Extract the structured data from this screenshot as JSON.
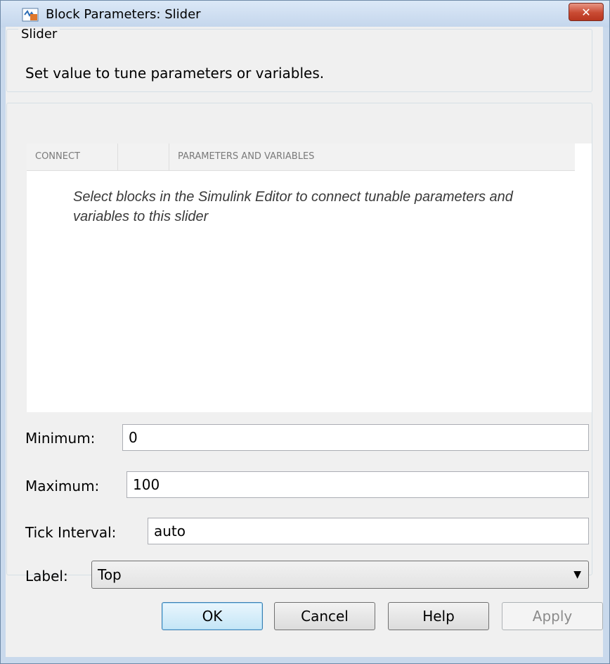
{
  "window": {
    "title": "Block Parameters: Slider",
    "close_glyph": "✕"
  },
  "block_group": {
    "legend": "Slider",
    "description": "Set value to tune parameters or variables."
  },
  "connect_table": {
    "columns": [
      "CONNECT",
      "",
      "PARAMETERS AND VARIABLES"
    ],
    "empty_hint": "Select blocks in the Simulink Editor to connect tunable parameters and variables to this slider"
  },
  "fields": {
    "minimum": {
      "label": "Minimum:",
      "value": "0"
    },
    "maximum": {
      "label": "Maximum:",
      "value": "100"
    },
    "tick_interval": {
      "label": "Tick Interval:",
      "value": "auto"
    },
    "label": {
      "label": "Label:",
      "value": "Top",
      "arrow": "▼"
    }
  },
  "buttons": {
    "ok": "OK",
    "cancel": "Cancel",
    "help": "Help",
    "apply": "Apply"
  },
  "colors": {
    "titlebar": "#c9d9ec",
    "close_button": "#c94a33",
    "default_button_border": "#3c7fb1"
  }
}
